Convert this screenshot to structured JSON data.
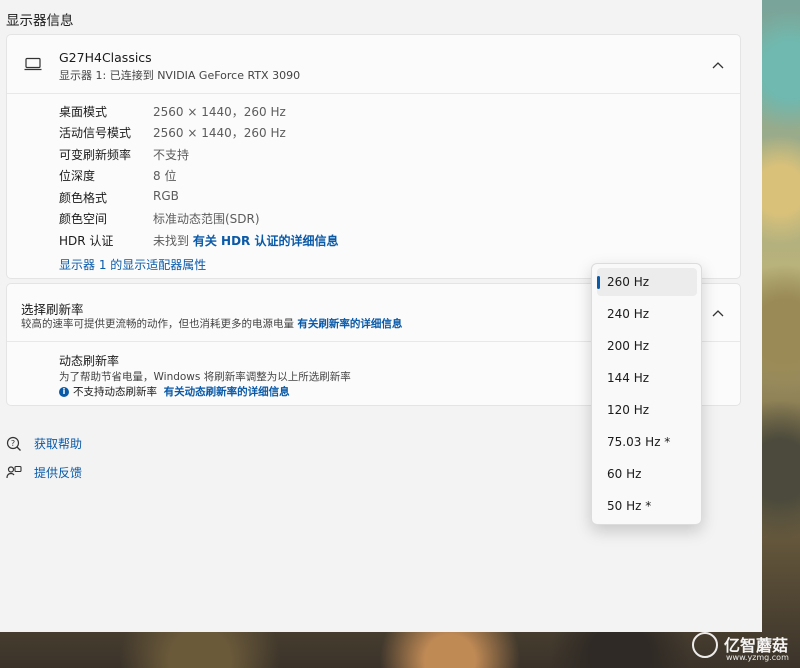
{
  "section_title": "显示器信息",
  "monitor": {
    "name": "G27H4Classics",
    "subtitle": "显示器 1: 已连接到 NVIDIA GeForce RTX 3090",
    "rows": [
      {
        "label": "桌面模式",
        "value": "2560 × 1440，260 Hz"
      },
      {
        "label": "活动信号模式",
        "value": "2560 × 1440，260 Hz"
      },
      {
        "label": "可变刷新频率",
        "value": "不支持"
      },
      {
        "label": "位深度",
        "value": "8 位"
      },
      {
        "label": "颜色格式",
        "value": "RGB"
      },
      {
        "label": "颜色空间",
        "value": "标准动态范围(SDR)"
      },
      {
        "label": "HDR 认证",
        "value": "未找到",
        "link": "有关 HDR 认证的详细信息"
      }
    ],
    "adapter_link": "显示器 1 的显示适配器属性"
  },
  "refresh": {
    "title": "选择刷新率",
    "subtitle": "较高的速率可提供更流畅的动作，但也消耗更多的电源电量",
    "subtitle_link": "有关刷新率的详细信息",
    "dynamic_title": "动态刷新率",
    "dynamic_sub": "为了帮助节省电量，Windows 将刷新率调整为以上所选刷新率",
    "dynamic_note": "不支持动态刷新率",
    "dynamic_link": "有关动态刷新率的详细信息"
  },
  "help": {
    "get_help": "获取帮助",
    "feedback": "提供反馈"
  },
  "dropdown": {
    "options": [
      "260 Hz",
      "240 Hz",
      "200 Hz",
      "144 Hz",
      "120 Hz",
      "75.03 Hz *",
      "60 Hz",
      "50 Hz *"
    ],
    "selected": "260 Hz"
  },
  "watermark": {
    "text": "亿智蘑菇",
    "url": "www.yzmg.com"
  },
  "colors": {
    "accent": "#0a5aa8",
    "window_bg": "#f3f3f3",
    "card_bg": "#fbfbfb"
  }
}
